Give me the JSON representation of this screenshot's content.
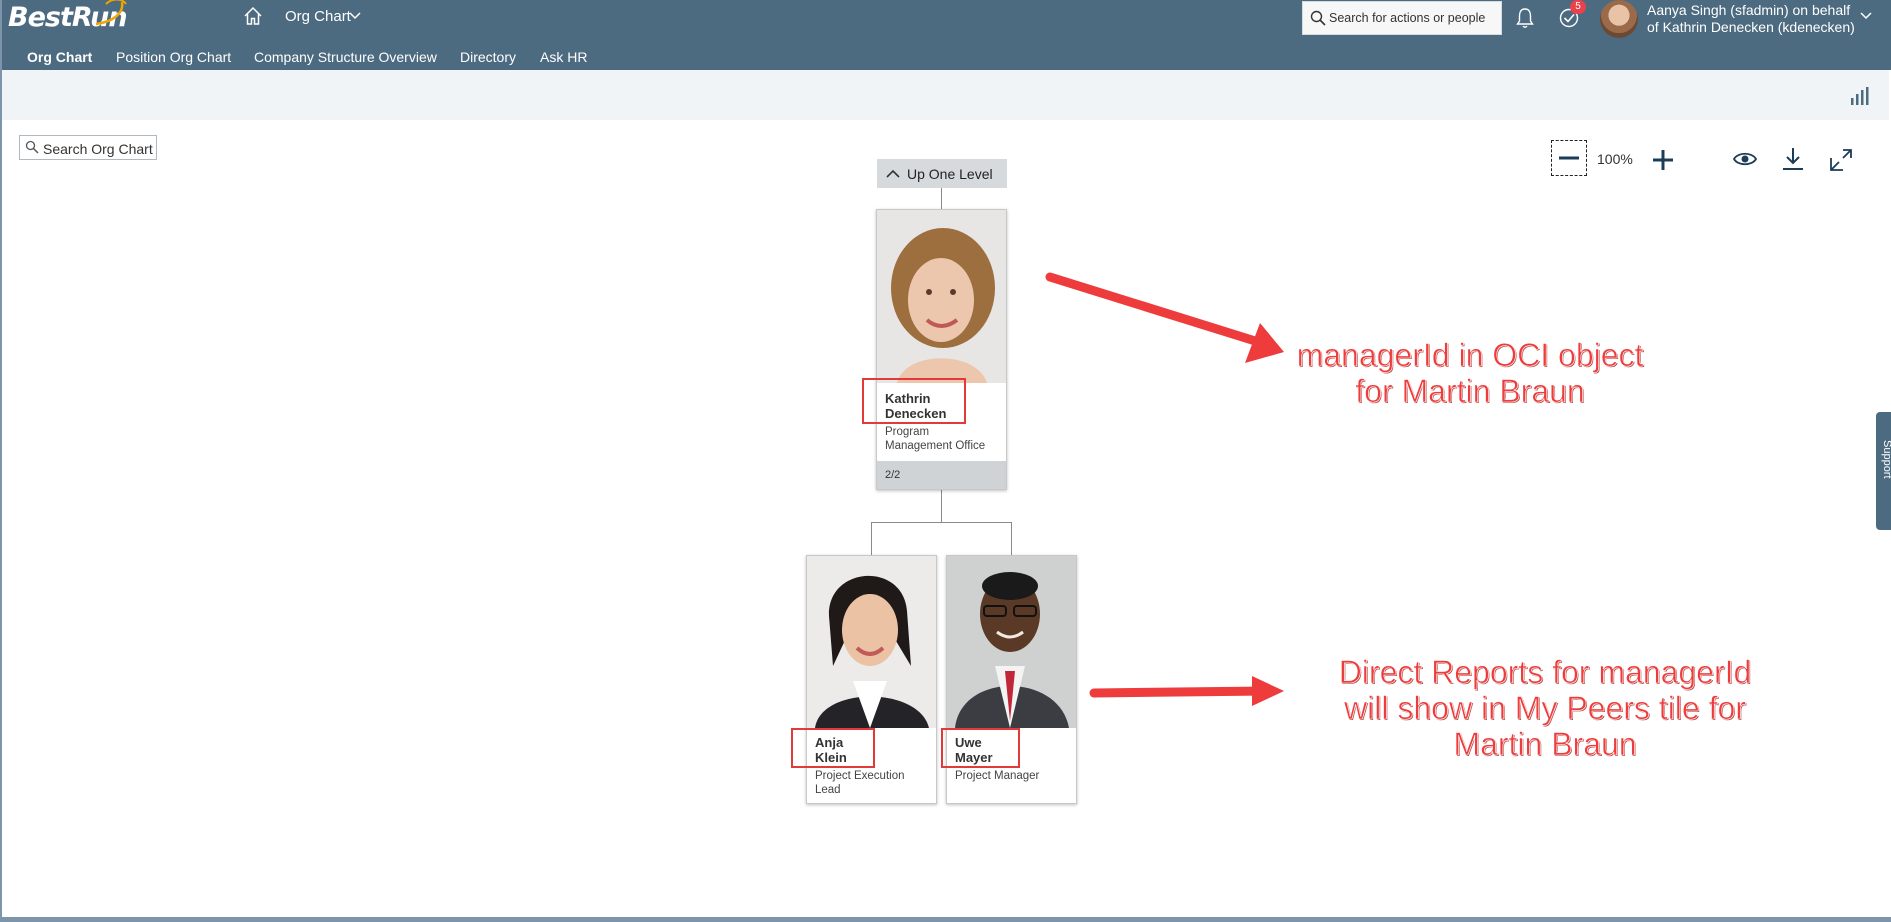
{
  "shell": {
    "logo": "BestRun",
    "app_title": "Org Chart",
    "search_placeholder": "Search for actions or people",
    "notification_count": "5",
    "user_line1": "Aanya Singh (sfadmin) on behalf",
    "user_line2": "of Kathrin Denecken (kdenecken)"
  },
  "nav": {
    "items": [
      "Org Chart",
      "Position Org Chart",
      "Company Structure Overview",
      "Directory",
      "Ask HR"
    ],
    "active": "Org Chart"
  },
  "toolbar": {
    "search_placeholder": "Search Org Chart",
    "zoom": "100%"
  },
  "orgchart": {
    "up_label": "Up One Level",
    "manager": {
      "name_first": "Kathrin",
      "name_last": "Denecken",
      "title_line1": "Program",
      "title_line2": "Management Office",
      "count": "2/2"
    },
    "reports": [
      {
        "name_first": "Anja",
        "name_last": "Klein",
        "title_line1": "Project Execution",
        "title_line2": "Lead"
      },
      {
        "name_first": "Uwe",
        "name_last": "Mayer",
        "title_line1": "Project Manager",
        "title_line2": ""
      }
    ]
  },
  "annotations": {
    "top": [
      "managerId in OCI object",
      "for Martin Braun"
    ],
    "bottom": [
      "Direct Reports for managerId",
      "will show in My Peers tile for",
      "Martin Braun"
    ],
    "color": "#ee3b3b"
  },
  "side_tab": "Support",
  "colors": {
    "shell": "#4c6a80",
    "subbar": "#f1f4f7",
    "accent": "#0a6ed1"
  }
}
